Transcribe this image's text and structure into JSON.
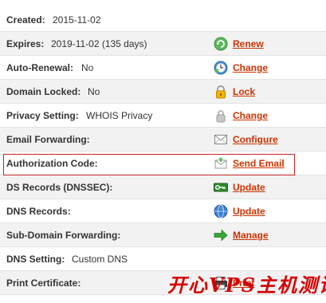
{
  "rows": [
    {
      "label": "Created:",
      "value": "2015-11-02"
    },
    {
      "label": "Expires:",
      "value": "2019-11-02 (135 days)",
      "icon": "renew-icon",
      "action": "Renew"
    },
    {
      "label": "Auto-Renewal:",
      "value": "No",
      "icon": "clock-icon",
      "action": "Change"
    },
    {
      "label": "Domain Locked:",
      "value": "No",
      "icon": "lock-icon",
      "action": "Lock"
    },
    {
      "label": "Privacy Setting:",
      "value": "WHOIS Privacy",
      "icon": "privacy-icon",
      "action": "Change"
    },
    {
      "label": "Email Forwarding:",
      "value": "",
      "icon": "envelope-icon",
      "action": "Configure"
    },
    {
      "label": "Authorization Code:",
      "value": "",
      "icon": "email-send-icon",
      "action": "Send Email"
    },
    {
      "label": "DS Records (DNSSEC):",
      "value": "",
      "icon": "key-icon",
      "action": "Update"
    },
    {
      "label": "DNS Records:",
      "value": "",
      "icon": "globe-icon",
      "action": "Update"
    },
    {
      "label": "Sub-Domain Forwarding:",
      "value": "",
      "icon": "arrow-right-icon",
      "action": "Manage"
    },
    {
      "label": "DNS Setting:",
      "value": "Custom DNS"
    },
    {
      "label": "Print Certificate:",
      "value": "",
      "icon": "printer-icon",
      "action": "Print"
    }
  ],
  "watermark": "开心VPS主机测评",
  "colors": {
    "link": "#cc3300",
    "highlight_border": "#cc2222",
    "row_alt": "#f2f2f2",
    "watermark": "#d40000"
  }
}
